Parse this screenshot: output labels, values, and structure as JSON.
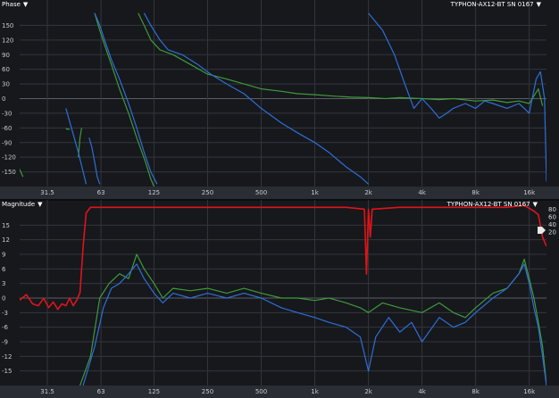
{
  "phase_panel": {
    "title": "Phase",
    "device": "TYPHON-AX12-BT SN 0167",
    "y_ticks": [
      "150",
      "120",
      "90",
      "60",
      "30",
      "0",
      "-30",
      "-60",
      "-90",
      "-120",
      "-150"
    ],
    "freq_labels": [
      "31.5",
      "63",
      "125",
      "250",
      "500",
      "1k",
      "2k",
      "4k",
      "8k",
      "16k"
    ]
  },
  "magnitude_panel": {
    "title": "Magnitude",
    "device": "TYPHON-AX12-BT SN 0167",
    "y_ticks": [
      "15",
      "12",
      "9",
      "6",
      "3",
      "0",
      "-3",
      "-6",
      "-9",
      "-12",
      "-15"
    ],
    "right_ticks": [
      "80",
      "60",
      "40",
      "20"
    ],
    "freq_labels": [
      "31.5",
      "63",
      "125",
      "250",
      "500",
      "1k",
      "2k",
      "4k",
      "8k",
      "16k"
    ]
  },
  "icons": {
    "dropdown": "caret-down-icon",
    "marker": "level-marker-icon"
  },
  "colors": {
    "background": "#1a1c20",
    "grid": "#33363c",
    "green_trace": "#3f9a3a",
    "blue_trace": "#2f6ed8",
    "red_trace": "#e0141a"
  },
  "chart_data": [
    {
      "type": "line",
      "title": "Phase",
      "x_scale": "log",
      "xlim": [
        22,
        20000
      ],
      "ylim": [
        -180,
        180
      ],
      "y_ticks": [
        150,
        120,
        90,
        60,
        30,
        0,
        -30,
        -60,
        -90,
        -120,
        -150
      ],
      "x_ticks": [
        31.5,
        63,
        125,
        250,
        500,
        1000,
        2000,
        4000,
        8000,
        16000
      ],
      "grid": true,
      "series": [
        {
          "color": "#3f9a3a",
          "segments": [
            [
              [
                21,
                -130
              ],
              [
                23,
                -160
              ]
            ],
            [
              [
                40,
                -62
              ],
              [
                42,
                -63
              ]
            ],
            [
              [
                47,
                -120
              ],
              [
                48,
                -80
              ],
              [
                49,
                -60
              ]
            ],
            [
              [
                58,
                175
              ],
              [
                62,
                140
              ],
              [
                66,
                110
              ],
              [
                72,
                70
              ],
              [
                80,
                20
              ],
              [
                90,
                -30
              ],
              [
                100,
                -80
              ],
              [
                112,
                -130
              ],
              [
                120,
                -165
              ],
              [
                125,
                -180
              ]
            ],
            [
              [
                102,
                175
              ],
              [
                110,
                150
              ],
              [
                120,
                120
              ],
              [
                135,
                100
              ],
              [
                160,
                90
              ],
              [
                200,
                70
              ],
              [
                250,
                50
              ],
              [
                320,
                40
              ],
              [
                400,
                30
              ],
              [
                500,
                20
              ],
              [
                650,
                15
              ],
              [
                800,
                10
              ],
              [
                1000,
                8
              ],
              [
                1300,
                5
              ],
              [
                1600,
                3
              ],
              [
                2000,
                2
              ],
              [
                2500,
                0
              ],
              [
                3000,
                2
              ],
              [
                4000,
                0
              ],
              [
                5000,
                -2
              ],
              [
                6000,
                0
              ],
              [
                8000,
                -5
              ],
              [
                10000,
                -3
              ],
              [
                12000,
                -8
              ],
              [
                14000,
                -5
              ],
              [
                16000,
                -10
              ],
              [
                18000,
                20
              ],
              [
                19000,
                -15
              ]
            ]
          ]
        },
        {
          "color": "#2f6ed8",
          "segments": [
            [
              [
                40,
                -20
              ],
              [
                43,
                -60
              ],
              [
                47,
                -110
              ],
              [
                50,
                -150
              ],
              [
                52,
                -175
              ]
            ],
            [
              [
                54,
                -80
              ],
              [
                56,
                -100
              ],
              [
                58,
                -130
              ],
              [
                60,
                -160
              ],
              [
                62,
                -175
              ]
            ],
            [
              [
                58,
                175
              ],
              [
                62,
                150
              ],
              [
                66,
                120
              ],
              [
                72,
                80
              ],
              [
                80,
                40
              ],
              [
                90,
                -10
              ],
              [
                100,
                -60
              ],
              [
                110,
                -110
              ],
              [
                120,
                -150
              ],
              [
                130,
                -175
              ]
            ],
            [
              [
                110,
                175
              ],
              [
                120,
                150
              ],
              [
                135,
                120
              ],
              [
                150,
                100
              ],
              [
                180,
                90
              ],
              [
                220,
                70
              ],
              [
                260,
                50
              ],
              [
                320,
                30
              ],
              [
                400,
                10
              ],
              [
                500,
                -20
              ],
              [
                650,
                -50
              ],
              [
                800,
                -70
              ],
              [
                1000,
                -90
              ],
              [
                1200,
                -110
              ],
              [
                1500,
                -140
              ],
              [
                1800,
                -160
              ],
              [
                2000,
                -175
              ]
            ],
            [
              [
                2000,
                175
              ],
              [
                2400,
                140
              ],
              [
                2800,
                90
              ],
              [
                3200,
                30
              ],
              [
                3600,
                -20
              ],
              [
                4000,
                0
              ],
              [
                4500,
                -20
              ],
              [
                5000,
                -40
              ],
              [
                5500,
                -30
              ],
              [
                6000,
                -20
              ],
              [
                7000,
                -10
              ],
              [
                8000,
                -20
              ],
              [
                9000,
                -5
              ],
              [
                10000,
                -10
              ],
              [
                12000,
                -20
              ],
              [
                14000,
                -10
              ],
              [
                15000,
                -20
              ],
              [
                16000,
                -30
              ],
              [
                17500,
                40
              ],
              [
                18500,
                55
              ],
              [
                19500,
                0
              ],
              [
                20000,
                -170
              ]
            ]
          ]
        }
      ]
    },
    {
      "type": "line",
      "title": "Magnitude",
      "x_scale": "log",
      "xlim": [
        22,
        20000
      ],
      "ylim": [
        -18,
        18
      ],
      "right_ylim": [
        0,
        100
      ],
      "y_ticks": [
        15,
        12,
        9,
        6,
        3,
        0,
        -3,
        -6,
        -9,
        -12,
        -15
      ],
      "right_ticks": [
        80,
        60,
        40,
        20
      ],
      "x_ticks": [
        31.5,
        63,
        125,
        250,
        500,
        1000,
        2000,
        4000,
        8000,
        16000
      ],
      "grid": true,
      "series": [
        {
          "color": "#3f9a3a",
          "axis": "left",
          "segments": [
            [
              [
                48,
                -18
              ],
              [
                55,
                -12
              ],
              [
                62,
                0
              ],
              [
                70,
                3
              ],
              [
                80,
                5
              ],
              [
                90,
                4
              ],
              [
                100,
                9
              ],
              [
                110,
                6
              ],
              [
                125,
                3
              ],
              [
                140,
                0
              ],
              [
                160,
                2
              ],
              [
                200,
                1.5
              ],
              [
                250,
                2
              ],
              [
                320,
                1
              ],
              [
                400,
                2
              ],
              [
                500,
                1
              ],
              [
                650,
                0
              ],
              [
                800,
                0
              ],
              [
                1000,
                -0.5
              ],
              [
                1200,
                0
              ],
              [
                1500,
                -1
              ],
              [
                1800,
                -2
              ],
              [
                2000,
                -3
              ],
              [
                2400,
                -1
              ],
              [
                3000,
                -2
              ],
              [
                4000,
                -3
              ],
              [
                5000,
                -1
              ],
              [
                6000,
                -3
              ],
              [
                7000,
                -4
              ],
              [
                8000,
                -2
              ],
              [
                10000,
                1
              ],
              [
                12000,
                2
              ],
              [
                14000,
                5
              ],
              [
                15000,
                8
              ],
              [
                16000,
                4
              ],
              [
                17000,
                0
              ],
              [
                18000,
                -5
              ],
              [
                19000,
                -10
              ],
              [
                20000,
                -18
              ]
            ]
          ]
        },
        {
          "color": "#2f6ed8",
          "axis": "left",
          "segments": [
            [
              [
                50,
                -18
              ],
              [
                58,
                -10
              ],
              [
                65,
                -2
              ],
              [
                72,
                2
              ],
              [
                80,
                3
              ],
              [
                90,
                5
              ],
              [
                100,
                7
              ],
              [
                110,
                4
              ],
              [
                125,
                1
              ],
              [
                140,
                -1
              ],
              [
                160,
                1
              ],
              [
                200,
                0
              ],
              [
                250,
                1
              ],
              [
                320,
                0
              ],
              [
                400,
                1
              ],
              [
                500,
                0
              ],
              [
                650,
                -2
              ],
              [
                800,
                -3
              ],
              [
                1000,
                -4
              ],
              [
                1200,
                -5
              ],
              [
                1500,
                -6
              ],
              [
                1800,
                -8
              ],
              [
                2000,
                -15
              ],
              [
                2200,
                -8
              ],
              [
                2600,
                -4
              ],
              [
                3000,
                -7
              ],
              [
                3500,
                -5
              ],
              [
                4000,
                -9
              ],
              [
                5000,
                -4
              ],
              [
                6000,
                -6
              ],
              [
                7000,
                -5
              ],
              [
                8000,
                -3
              ],
              [
                10000,
                0
              ],
              [
                12000,
                2
              ],
              [
                14000,
                5
              ],
              [
                15000,
                7
              ],
              [
                16000,
                3
              ],
              [
                17000,
                -2
              ],
              [
                18000,
                -6
              ],
              [
                19000,
                -12
              ],
              [
                20000,
                -18
              ]
            ]
          ]
        },
        {
          "color": "#e0141a",
          "axis": "right",
          "segments": [
            [
              [
                20,
                42
              ],
              [
                22,
                46
              ],
              [
                24,
                49
              ],
              [
                26,
                44
              ],
              [
                28,
                43
              ],
              [
                30,
                47
              ],
              [
                32,
                42
              ],
              [
                34,
                45
              ],
              [
                36,
                41
              ],
              [
                38,
                44
              ],
              [
                40,
                43
              ],
              [
                42,
                47
              ],
              [
                44,
                43
              ],
              [
                46,
                46
              ],
              [
                48,
                50
              ],
              [
                50,
                75
              ],
              [
                52,
                93
              ],
              [
                55,
                96
              ],
              [
                60,
                96
              ],
              [
                70,
                96
              ],
              [
                100,
                96
              ],
              [
                200,
                96
              ],
              [
                400,
                96
              ],
              [
                800,
                96
              ],
              [
                1500,
                96
              ],
              [
                1900,
                95
              ],
              [
                1950,
                60
              ],
              [
                2000,
                95
              ],
              [
                2050,
                80
              ],
              [
                2100,
                95
              ],
              [
                3000,
                96
              ],
              [
                5000,
                96
              ],
              [
                8000,
                96
              ],
              [
                12000,
                96
              ],
              [
                15000,
                97
              ],
              [
                17000,
                94
              ],
              [
                18000,
                92
              ],
              [
                19000,
                80
              ],
              [
                20000,
                75
              ]
            ]
          ]
        }
      ]
    }
  ]
}
